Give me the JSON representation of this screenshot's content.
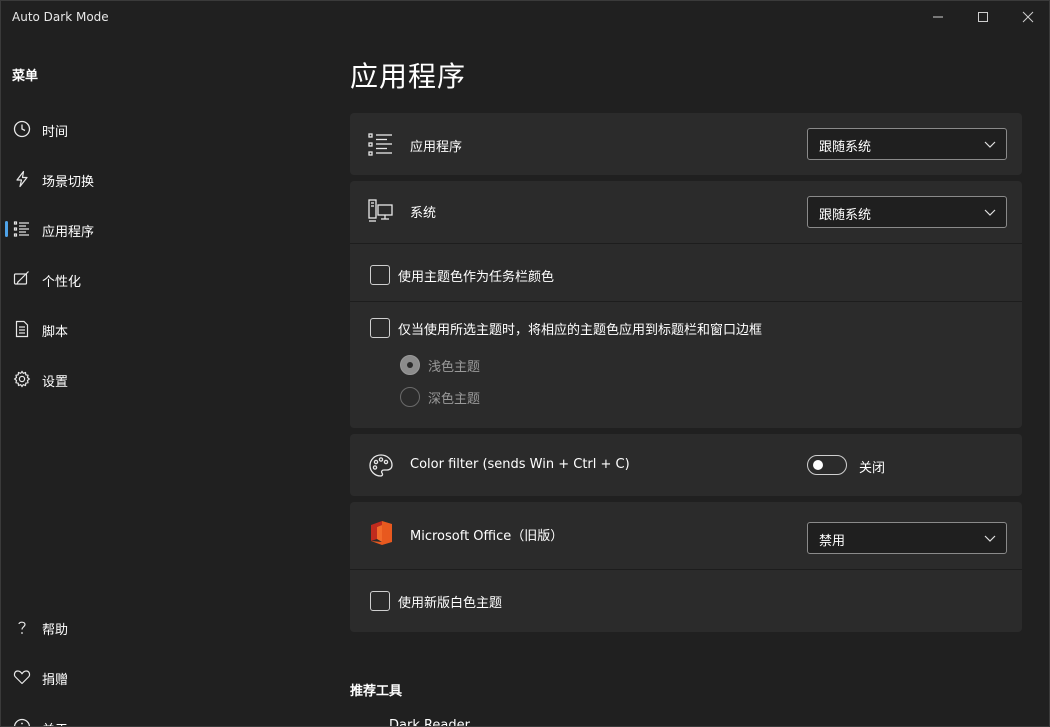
{
  "window": {
    "title": "Auto Dark Mode",
    "controls": {
      "minimize": "minimize",
      "maximize": "maximize",
      "close": "close"
    }
  },
  "sidebar": {
    "menu_title": "菜单",
    "items": [
      {
        "label": "时间",
        "icon": "clock-icon",
        "active": false
      },
      {
        "label": "场景切换",
        "icon": "lightning-icon",
        "active": false
      },
      {
        "label": "应用程序",
        "icon": "list-icon",
        "active": true
      },
      {
        "label": "个性化",
        "icon": "personalize-icon",
        "active": false
      },
      {
        "label": "脚本",
        "icon": "document-icon",
        "active": false
      },
      {
        "label": "设置",
        "icon": "gear-icon",
        "active": false
      }
    ],
    "footer_items": [
      {
        "label": "帮助",
        "icon": "question-icon"
      },
      {
        "label": "捐赠",
        "icon": "heart-icon"
      },
      {
        "label": "关于",
        "icon": "info-icon"
      }
    ]
  },
  "main": {
    "page_title": "应用程序",
    "apps_row": {
      "label": "应用程序",
      "select_value": "跟随系统"
    },
    "system_card": {
      "label": "系统",
      "select_value": "跟随系统",
      "taskbar_accent_checkbox": {
        "label": "使用主题色作为任务栏颜色",
        "checked": false
      },
      "titlebar_accent_checkbox": {
        "label": "仅当使用所选主题时，将相应的主题色应用到标题栏和窗口边框",
        "checked": false
      },
      "radio_options": [
        {
          "label": "浅色主题",
          "checked": true
        },
        {
          "label": "深色主题",
          "checked": false
        }
      ]
    },
    "color_filter": {
      "label": "Color filter (sends Win + Ctrl + C)",
      "toggle_state": "关闭",
      "on": false
    },
    "office_card": {
      "label": "Microsoft Office（旧版）",
      "select_value": "禁用",
      "white_theme_checkbox": {
        "label": "使用新版白色主题",
        "checked": false
      }
    },
    "recommended": {
      "title": "推荐工具",
      "first_tool": "Dark Reader"
    }
  },
  "colors": {
    "background": "#202020",
    "card": "#2b2b2b",
    "accent": "#4fa3e8",
    "office_orange": "#e8591f",
    "office_red": "#c02b1e"
  }
}
